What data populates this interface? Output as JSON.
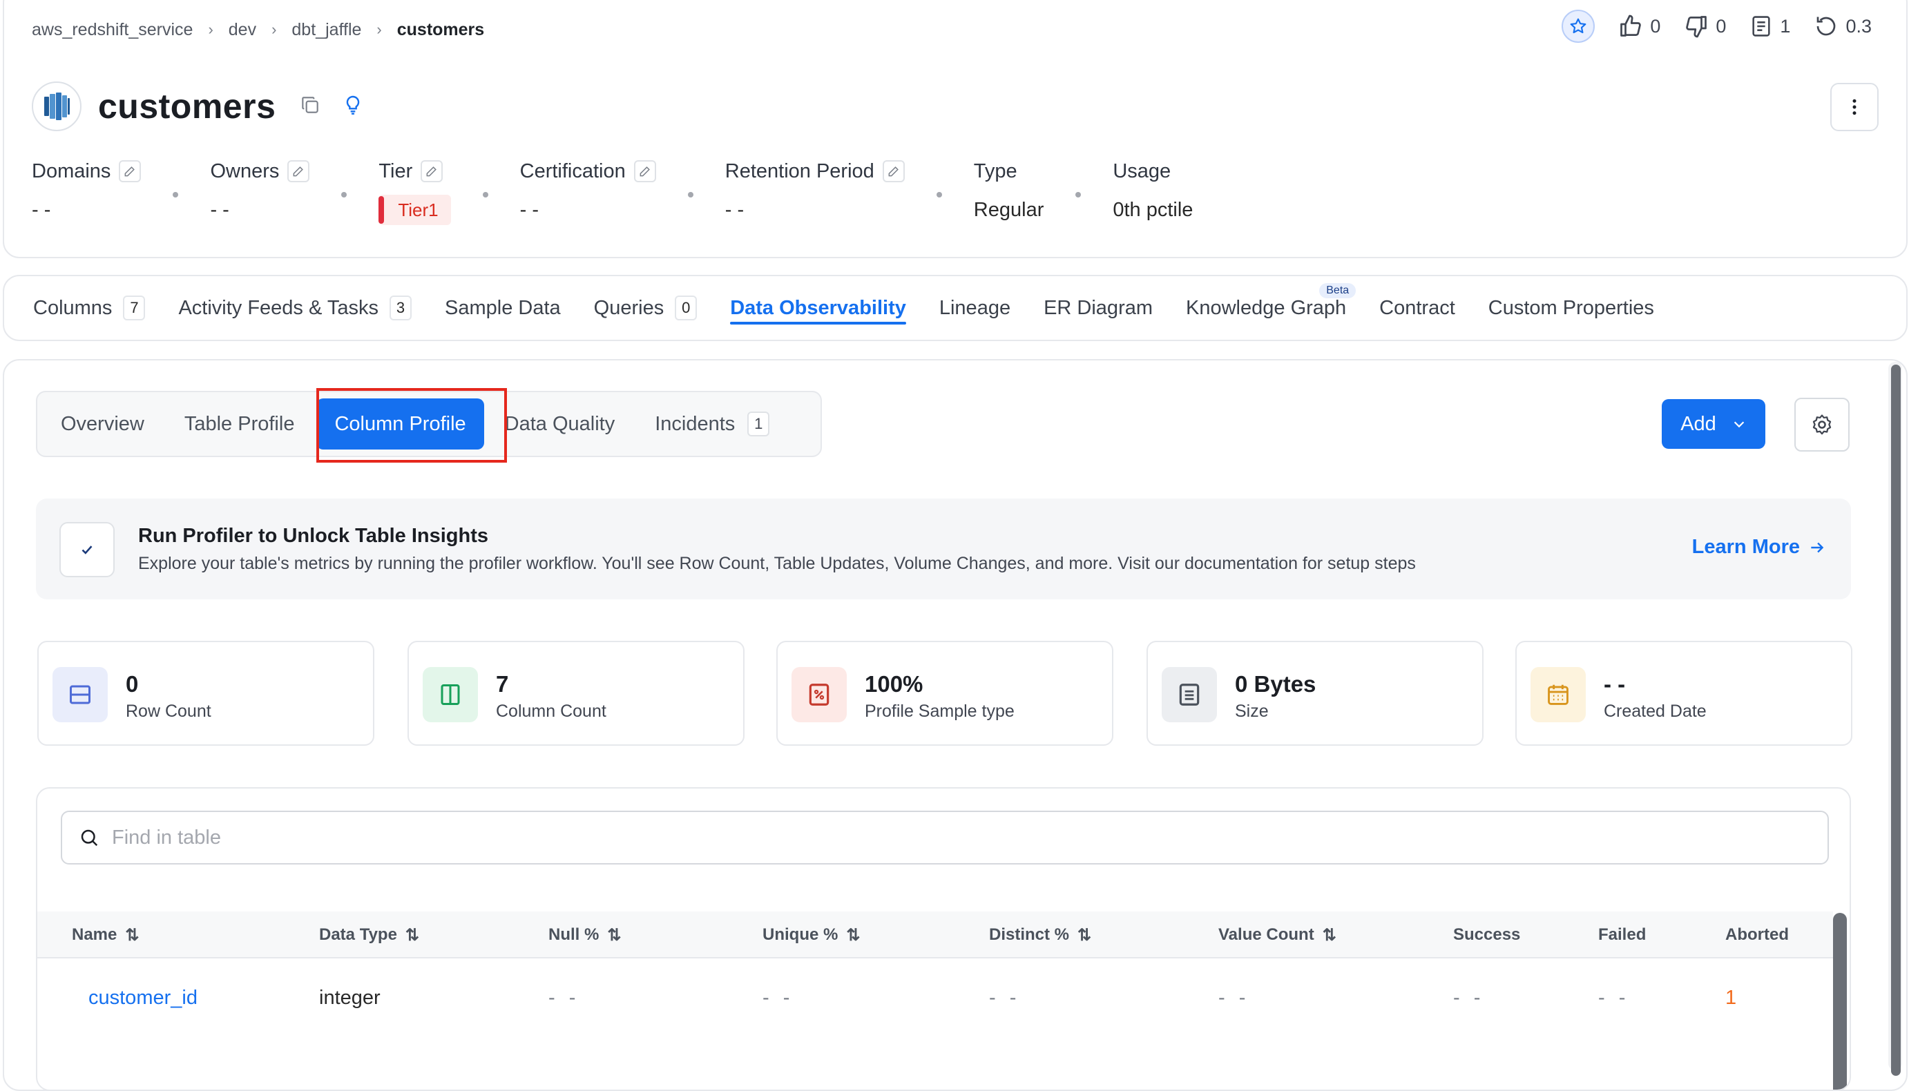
{
  "breadcrumb": [
    "aws_redshift_service",
    "dev",
    "dbt_jaffle",
    "customers"
  ],
  "header_actions": {
    "likes": "0",
    "dislikes": "0",
    "threads": "1",
    "version": "0.3"
  },
  "entity": {
    "title": "customers"
  },
  "meta": {
    "domains": {
      "label": "Domains",
      "value": "- -"
    },
    "owners": {
      "label": "Owners",
      "value": "- -"
    },
    "tier": {
      "label": "Tier",
      "value": "Tier1"
    },
    "certification": {
      "label": "Certification",
      "value": "- -"
    },
    "retention": {
      "label": "Retention Period",
      "value": "- -"
    },
    "type": {
      "label": "Type",
      "value": "Regular"
    },
    "usage": {
      "label": "Usage",
      "value": "0th pctile"
    }
  },
  "tabs": [
    {
      "label": "Columns",
      "count": "7"
    },
    {
      "label": "Activity Feeds & Tasks",
      "count": "3"
    },
    {
      "label": "Sample Data"
    },
    {
      "label": "Queries",
      "count": "0"
    },
    {
      "label": "Data Observability",
      "active": true
    },
    {
      "label": "Lineage"
    },
    {
      "label": "ER Diagram"
    },
    {
      "label": "Knowledge Graph",
      "badge": "Beta"
    },
    {
      "label": "Contract"
    },
    {
      "label": "Custom Properties"
    }
  ],
  "subtabs": [
    {
      "label": "Overview"
    },
    {
      "label": "Table Profile"
    },
    {
      "label": "Column Profile",
      "active": true
    },
    {
      "label": "Data Quality"
    },
    {
      "label": "Incidents",
      "count": "1"
    }
  ],
  "add_button": "Add",
  "banner": {
    "title": "Run Profiler to Unlock Table Insights",
    "text": "Explore your table's metrics by running the profiler workflow. You'll see Row Count, Table Updates, Volume Changes, and more. Visit our documentation for setup steps",
    "link": "Learn More"
  },
  "stats": [
    {
      "value": "0",
      "label": "Row Count",
      "icon": "row-count-icon",
      "color": "#4e6bd7",
      "bg": "#e9edfb"
    },
    {
      "value": "7",
      "label": "Column Count",
      "icon": "column-count-icon",
      "color": "#18a05a",
      "bg": "#e3f6ea"
    },
    {
      "value": "100%",
      "label": "Profile Sample type",
      "icon": "percent-icon",
      "color": "#c53b2e",
      "bg": "#fde9e6"
    },
    {
      "value": "0 Bytes",
      "label": "Size",
      "icon": "size-icon",
      "color": "#4b525c",
      "bg": "#eceef1"
    },
    {
      "value": "- -",
      "label": "Created Date",
      "icon": "calendar-icon",
      "color": "#d8941c",
      "bg": "#fdf3dd"
    }
  ],
  "search": {
    "placeholder": "Find in table"
  },
  "table": {
    "headers": [
      "Name",
      "Data Type",
      "Null %",
      "Unique %",
      "Distinct %",
      "Value Count",
      "Success",
      "Failed",
      "Aborted"
    ],
    "rows": [
      {
        "name": "customer_id",
        "type": "integer",
        "null": "- -",
        "unique": "- -",
        "distinct": "- -",
        "value_count": "- -",
        "success": "- -",
        "failed": "- -",
        "aborted": "1"
      }
    ]
  },
  "colors": {
    "accent": "#1570ef",
    "tier": "#d92d20",
    "aborted": "#f26b1d",
    "highlight": "#e5281d"
  }
}
